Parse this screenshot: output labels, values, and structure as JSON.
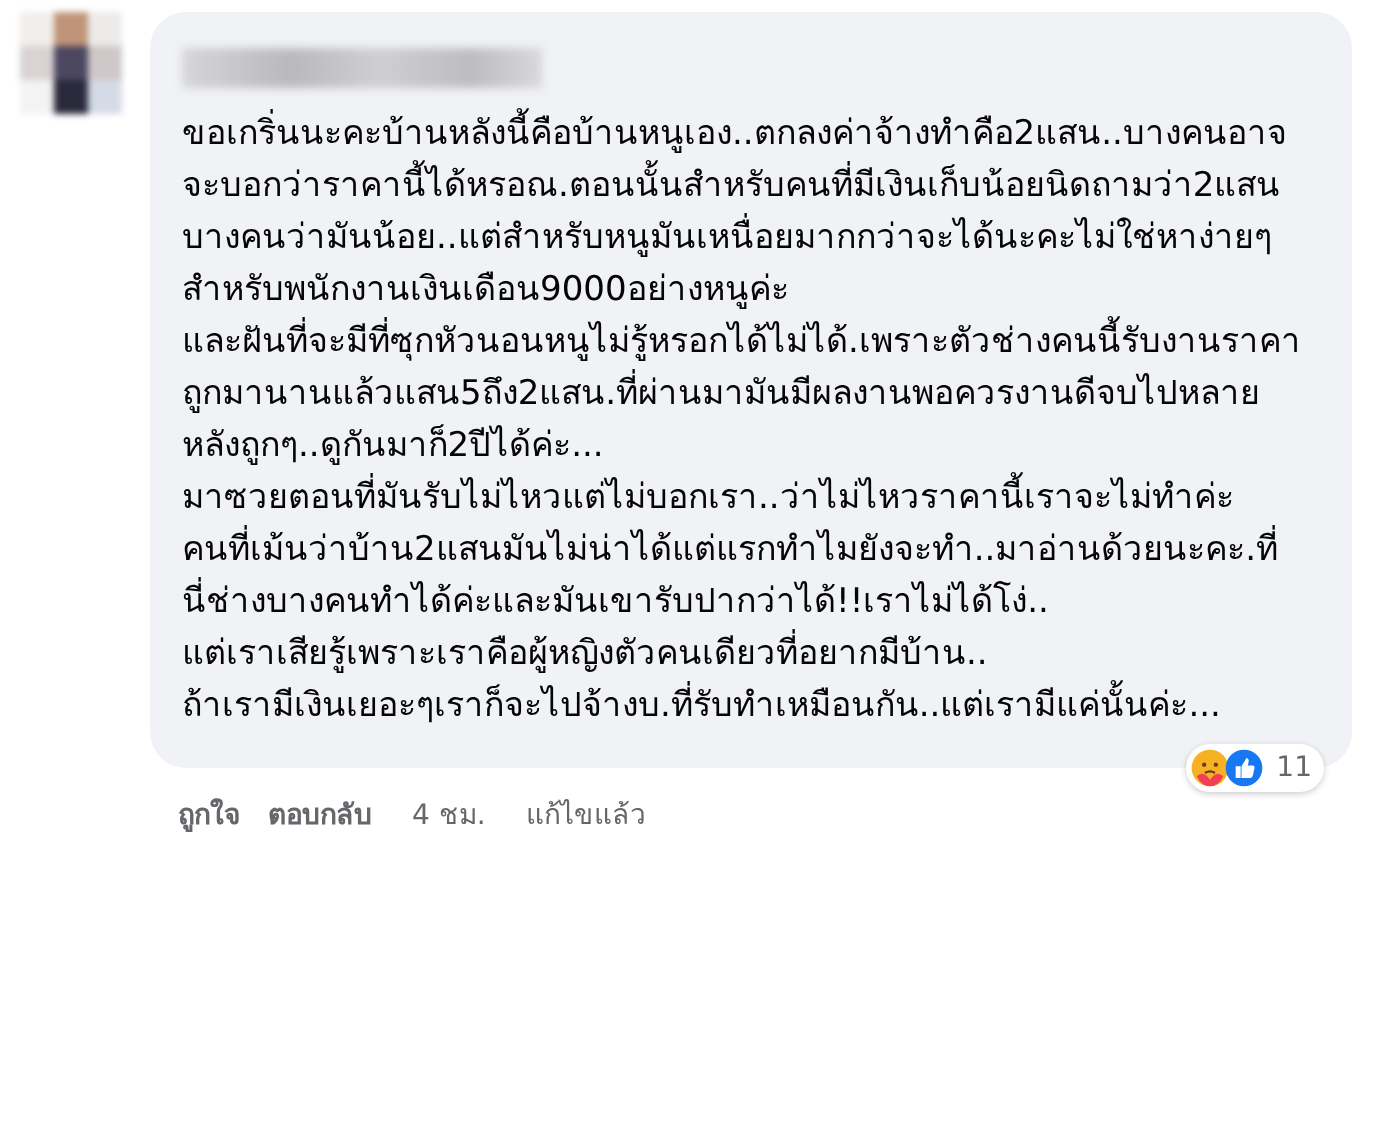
{
  "comment": {
    "paragraphs": [
      "ขอเกริ่นนะคะบ้านหลังนี้คือบ้านหนูเอง..ตกลงค่าจ้างทำคือ2แสน..บางคนอาจจะบอกว่าราคานี้ได้หรอณ.ตอนนั้นสำหรับคนที่มีเงินเก็บน้อยนิดถามว่า2แสนบางคนว่ามันน้อย..แต่สำหรับหนูมันเหนื่อยมากกว่าจะได้นะคะไม่ใช่หาง่ายๆสำหรับพนักงานเงินเดือน9000อย่างหนูค่ะ",
      "และฝันที่จะมีที่ซุกหัวนอนหนูไม่รู้หรอกได้ไม่ได้.เพราะตัวช่างคนนี้รับงานราคาถูกมานานแล้วแสน5ถึง2แสน.ที่ผ่านมามันมีผลงานพอควรงานดีจบไปหลายหลังถูกๆ..ดูกันมาก็2ปีได้ค่ะ...",
      "มาซวยตอนที่มันรับไม่ไหวแต่ไม่บอกเรา..ว่าไม่ไหวราคานี้เราจะไม่ทำค่ะ",
      "คนที่เม้นว่าบ้าน2แสนมันไม่น่าได้แต่แรกทำไมยังจะทำ..มาอ่านด้วยนะคะ.ที่นี่ช่างบางคนทำได้ค่ะและมันเขารับปากว่าได้!!เราไม่ได้โง่..",
      "แต่เราเสียรู้เพราะเราคือผู้หญิงตัวคนเดียวที่อยากมีบ้าน..",
      "ถ้าเรามีเงินเยอะๆเราก็จะไปจ้างบ.ที่รับทำเหมือนกัน..แต่เรามีแค่นั้นค่ะ..."
    ],
    "reactions": {
      "count": "11"
    },
    "actions": [
      {
        "label": "ถูกใจ",
        "kind": "link"
      },
      {
        "label": "ตอบกลับ",
        "kind": "link"
      },
      {
        "label": "4 ชม.",
        "kind": "time"
      },
      {
        "label": "แก้ไขแล้ว",
        "kind": "meta"
      }
    ]
  }
}
